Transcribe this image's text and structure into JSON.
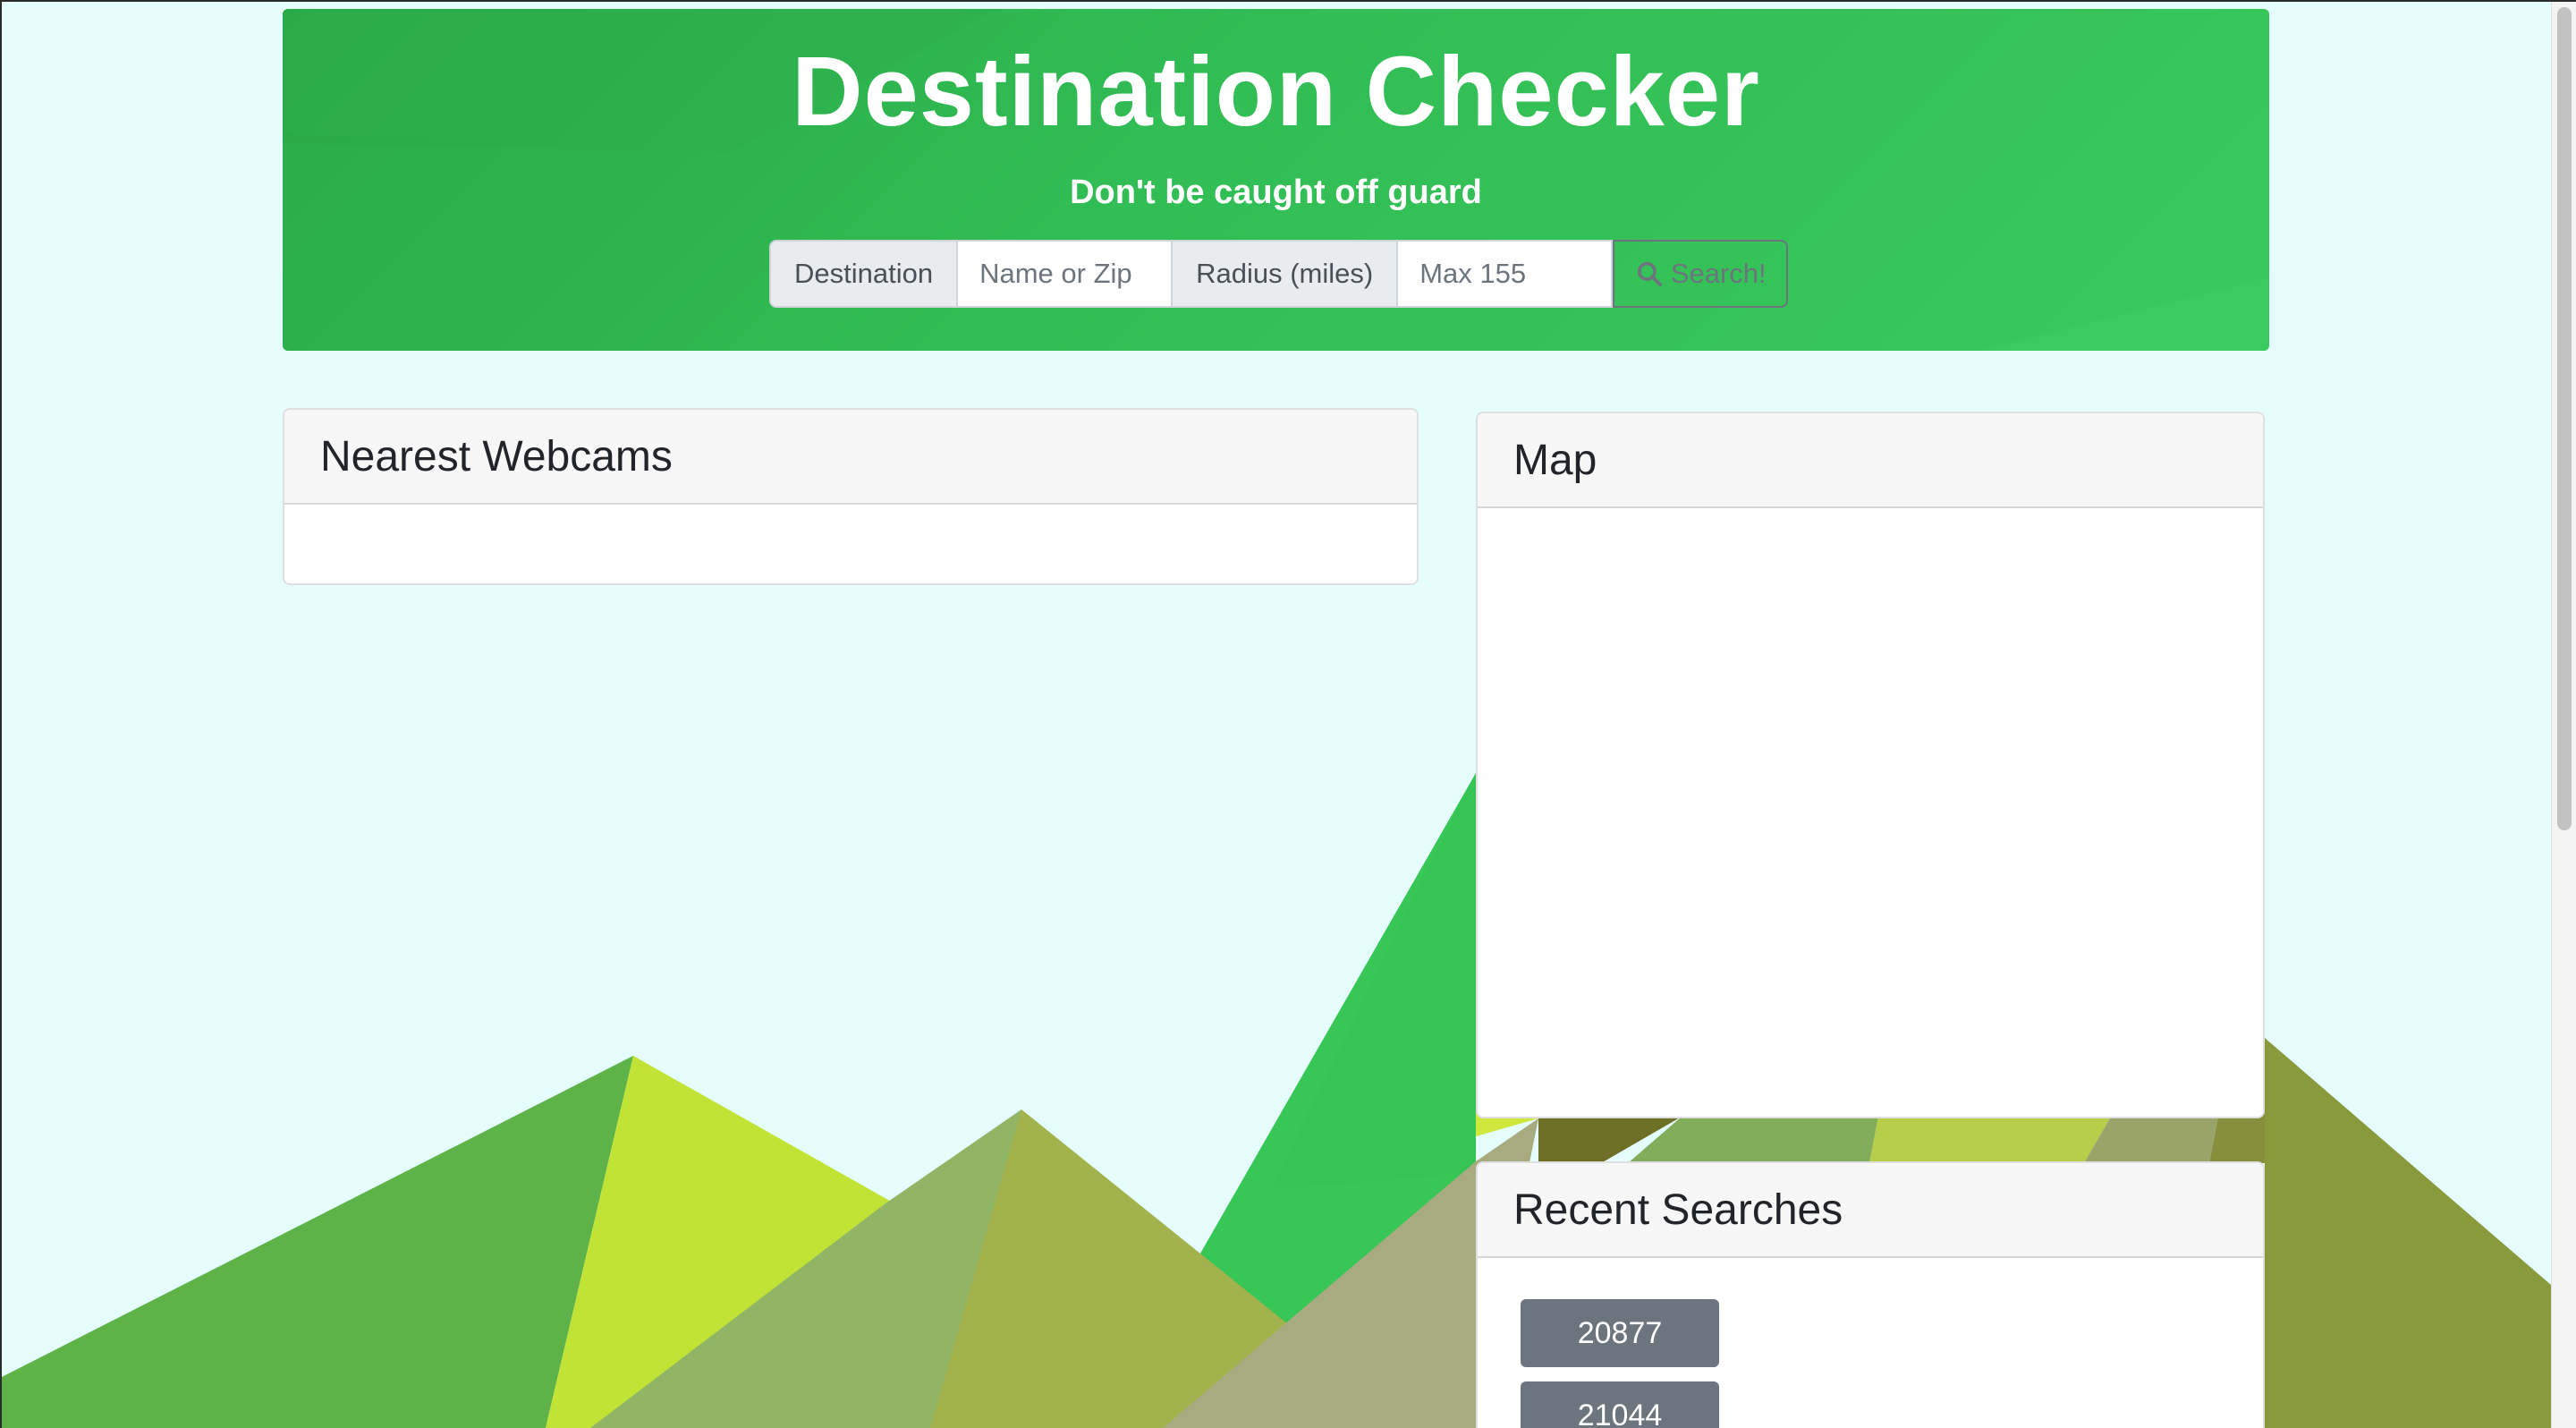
{
  "header": {
    "title": "Destination Checker",
    "subtitle": "Don't be caught off guard"
  },
  "search": {
    "destination_label": "Destination",
    "destination_placeholder": "Name or Zip",
    "radius_label": "Radius (miles)",
    "radius_placeholder": "Max 155",
    "button_label": "Search!",
    "button_icon": "search-icon"
  },
  "webcams": {
    "title": "Nearest Webcams"
  },
  "map": {
    "title": "Map"
  },
  "recent": {
    "title": "Recent Searches",
    "items": [
      "20877",
      "21044"
    ]
  },
  "colors": {
    "page_bg": "#e6fdfd",
    "hero_green": "#32bd55",
    "button_gray": "#6c757d"
  }
}
